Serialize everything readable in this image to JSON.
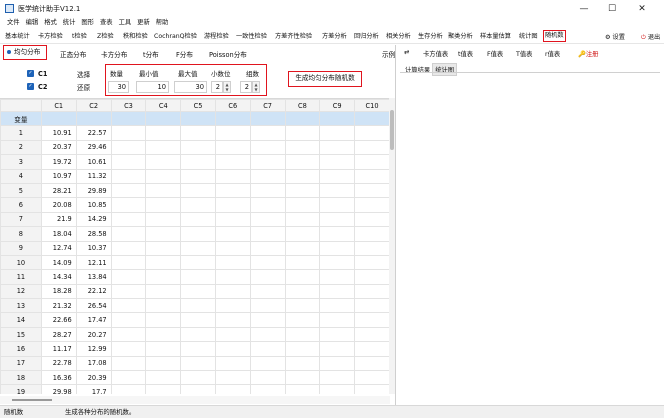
{
  "window": {
    "title": "医学统计助手V12.1",
    "min": "—",
    "max": "☐",
    "close": "✕",
    "icon": "app-chart-icon"
  },
  "menu": [
    "文件",
    "编辑",
    "格式",
    "统计",
    "图形",
    "查表",
    "工具",
    "更新",
    "帮助"
  ],
  "modules": [
    "基本统计",
    "卡方检验",
    "t检验",
    "Z检验",
    "秩和检验",
    "CochranQ检验",
    "游程检验",
    "一致性检验",
    "方差齐性检验",
    "方差分析",
    "回归分析",
    "相关分析",
    "生存分析",
    "聚类分析",
    "样本量估算",
    "统计图",
    "随机数"
  ],
  "toolbar_right": {
    "settings": "设置",
    "exit": "退出",
    "settings_icon": "gear-icon",
    "exit_icon": "power-icon"
  },
  "dist_tabs": {
    "active": "均匀分布",
    "others": [
      "正态分布",
      "卡方分布",
      "t分布",
      "F分布",
      "Poisson分布"
    ],
    "example": "示例"
  },
  "options": {
    "c1": "C1",
    "c2": "C2",
    "select": "选择",
    "restore": "还原"
  },
  "params": {
    "count_label": "数量",
    "min_label": "最小值",
    "max_label": "最大值",
    "decimals_label": "小数位",
    "groups_label": "组数",
    "count": "30",
    "min": "10",
    "max": "30",
    "decimals": "2",
    "groups": "2"
  },
  "generate_button": "生成均匀分布随机数",
  "grid": {
    "columns": [
      "C1",
      "C2",
      "C3",
      "C4",
      "C5",
      "C6",
      "C7",
      "C8",
      "C9",
      "C10"
    ],
    "var_label": "变量",
    "rows": [
      [
        "1",
        "10.91",
        "22.57"
      ],
      [
        "2",
        "20.37",
        "29.46"
      ],
      [
        "3",
        "19.72",
        "10.61"
      ],
      [
        "4",
        "10.97",
        "11.32"
      ],
      [
        "5",
        "28.21",
        "29.89"
      ],
      [
        "6",
        "20.08",
        "10.85"
      ],
      [
        "7",
        "21.9",
        "14.29"
      ],
      [
        "8",
        "18.04",
        "28.58"
      ],
      [
        "9",
        "12.74",
        "10.37"
      ],
      [
        "10",
        "14.09",
        "12.11"
      ],
      [
        "11",
        "14.34",
        "13.84"
      ],
      [
        "12",
        "18.28",
        "22.12"
      ],
      [
        "13",
        "21.32",
        "26.54"
      ],
      [
        "14",
        "22.66",
        "17.47"
      ],
      [
        "15",
        "28.27",
        "20.27"
      ],
      [
        "16",
        "11.17",
        "12.99"
      ],
      [
        "17",
        "22.78",
        "17.08"
      ],
      [
        "18",
        "16.36",
        "20.39"
      ],
      [
        "19",
        "29.98",
        "17.7"
      ],
      [
        "20",
        "11.65",
        "20.54"
      ]
    ]
  },
  "right_toolbar": {
    "tables": [
      "卡方值表",
      "t值表",
      "F值表",
      "T值表",
      "r值表"
    ],
    "register": "注册"
  },
  "right_tabs": [
    "计算结果",
    "统计图"
  ],
  "status": {
    "left": "随机数",
    "right": "生成各种分布的随机数。"
  },
  "colors": {
    "accent": "#e0141e",
    "blue": "#1e63b8",
    "selected_row": "#cfe3f6"
  }
}
